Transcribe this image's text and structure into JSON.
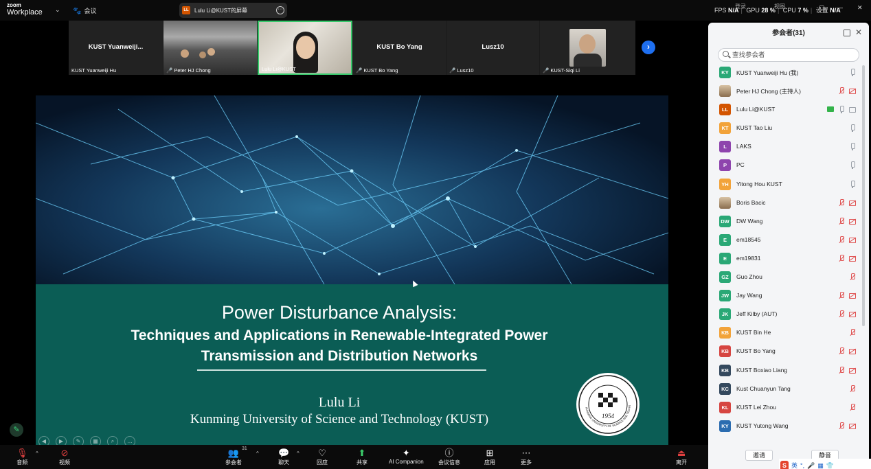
{
  "topbar": {
    "brand_small": "zoom",
    "brand_main": "Workplace",
    "meeting_label": "会议",
    "share_badge_initials": "LL",
    "share_title": "Lulu Li@KUST的屏幕",
    "stats": {
      "fps_label": "FPS",
      "fps_value": "N/A",
      "gpu_label": "GPU",
      "gpu_value": "28 %",
      "cpu_label": "CPU",
      "cpu_value": "7 %",
      "last_value": "N/A"
    },
    "overlay_text_1": "视图",
    "overlay_text_2": "登录",
    "overlay_text_3": "设置"
  },
  "strip": {
    "tiles": [
      {
        "center_name": "KUST  Yuanweiji...",
        "label": "KUST Yuanweiji Hu",
        "muted": false
      },
      {
        "center_name": "",
        "label": "Peter HJ Chong",
        "muted": true
      },
      {
        "center_name": "",
        "label": "Lulu Li@KUST",
        "muted": false
      },
      {
        "center_name": "KUST Bo Yang",
        "label": "KUST Bo Yang",
        "muted": true
      },
      {
        "center_name": "Lusz10",
        "label": "Lusz10",
        "muted": true
      },
      {
        "center_name": "",
        "label": "KUST-Siqi Li",
        "muted": true
      }
    ]
  },
  "slide": {
    "title_line1": "Power Disturbance Analysis:",
    "title_line2": "Techniques and Applications in Renewable-Integrated Power",
    "title_line3": "Transmission and Distribution Networks",
    "author": "Lulu Li",
    "affiliation": "Kunming University of Science and Technology (KUST)",
    "seal_year": "1954",
    "seal_text": "KUNMING UNIVERSITY OF SCIENCE AND TECHNOLOGY"
  },
  "panel": {
    "title": "参会者(31)",
    "search_placeholder": "查找参会者",
    "participants": [
      {
        "initials": "KY",
        "name": "KUST Yuanweiji Hu (我)",
        "color": "#2aa876",
        "mic": "on",
        "cam": "none"
      },
      {
        "initials": "",
        "name": "Peter HJ Chong (主持人)",
        "color": "#7a6a5a",
        "mic": "off",
        "cam": "on-red"
      },
      {
        "initials": "LL",
        "name": "Lulu Li@KUST",
        "color": "#d35400",
        "mic": "on",
        "cam": "on",
        "sharing": true
      },
      {
        "initials": "KT",
        "name": "KUST Tao Liu",
        "color": "#f2a33a",
        "mic": "on",
        "cam": "none"
      },
      {
        "initials": "L",
        "name": "LAKS",
        "color": "#8e44ad",
        "mic": "on",
        "cam": "none"
      },
      {
        "initials": "P",
        "name": "PC",
        "color": "#8e44ad",
        "mic": "on",
        "cam": "none"
      },
      {
        "initials": "YH",
        "name": "Yitong Hou KUST",
        "color": "#f2a33a",
        "mic": "on",
        "cam": "none"
      },
      {
        "initials": "",
        "name": "Boris Bacic",
        "color": "#a88766",
        "mic": "off",
        "cam": "off"
      },
      {
        "initials": "DW",
        "name": "DW Wang",
        "color": "#2aa876",
        "mic": "off",
        "cam": "off"
      },
      {
        "initials": "E",
        "name": "em18545",
        "color": "#2aa876",
        "mic": "off",
        "cam": "off"
      },
      {
        "initials": "E",
        "name": "em19831",
        "color": "#2aa876",
        "mic": "off",
        "cam": "off"
      },
      {
        "initials": "GZ",
        "name": "Guo Zhou",
        "color": "#2aa876",
        "mic": "off-solo",
        "cam": "none"
      },
      {
        "initials": "JW",
        "name": "Jay Wang",
        "color": "#2aa876",
        "mic": "off",
        "cam": "off"
      },
      {
        "initials": "JK",
        "name": "Jeff Kilby (AUT)",
        "color": "#2aa876",
        "mic": "off",
        "cam": "off"
      },
      {
        "initials": "KB",
        "name": "KUST Bin He",
        "color": "#f2a33a",
        "mic": "off-solo",
        "cam": "none"
      },
      {
        "initials": "KB",
        "name": "KUST Bo Yang",
        "color": "#d64541",
        "mic": "off",
        "cam": "off"
      },
      {
        "initials": "KB",
        "name": "KUST Boxiao Liang",
        "color": "#34495e",
        "mic": "off",
        "cam": "off"
      },
      {
        "initials": "KC",
        "name": "Kust Chuanyun Tang",
        "color": "#34495e",
        "mic": "off-solo",
        "cam": "none"
      },
      {
        "initials": "KL",
        "name": "KUST Lei Zhou",
        "color": "#d64541",
        "mic": "off-solo",
        "cam": "none"
      },
      {
        "initials": "KY",
        "name": "KUST Yutong Wang",
        "color": "#2b6cb0",
        "mic": "off",
        "cam": "off"
      }
    ],
    "invite_label": "邀请",
    "mute_all_label": "静音"
  },
  "toolbar": {
    "audio_label": "音频",
    "video_label": "视频",
    "participants_label": "参会者",
    "participants_count": "31",
    "chat_label": "聊天",
    "react_label": "回应",
    "share_label": "共享",
    "ai_label": "AI Companion",
    "info_label": "会议信息",
    "apps_label": "应用",
    "more_label": "更多",
    "leave_label": "离开"
  },
  "ime": {
    "lang": "英"
  },
  "colors": {
    "slide_bg": "#0b5d55",
    "active_speaker": "#37c86b",
    "accent_blue": "#1e6ff0",
    "muted_red": "#e05353"
  }
}
